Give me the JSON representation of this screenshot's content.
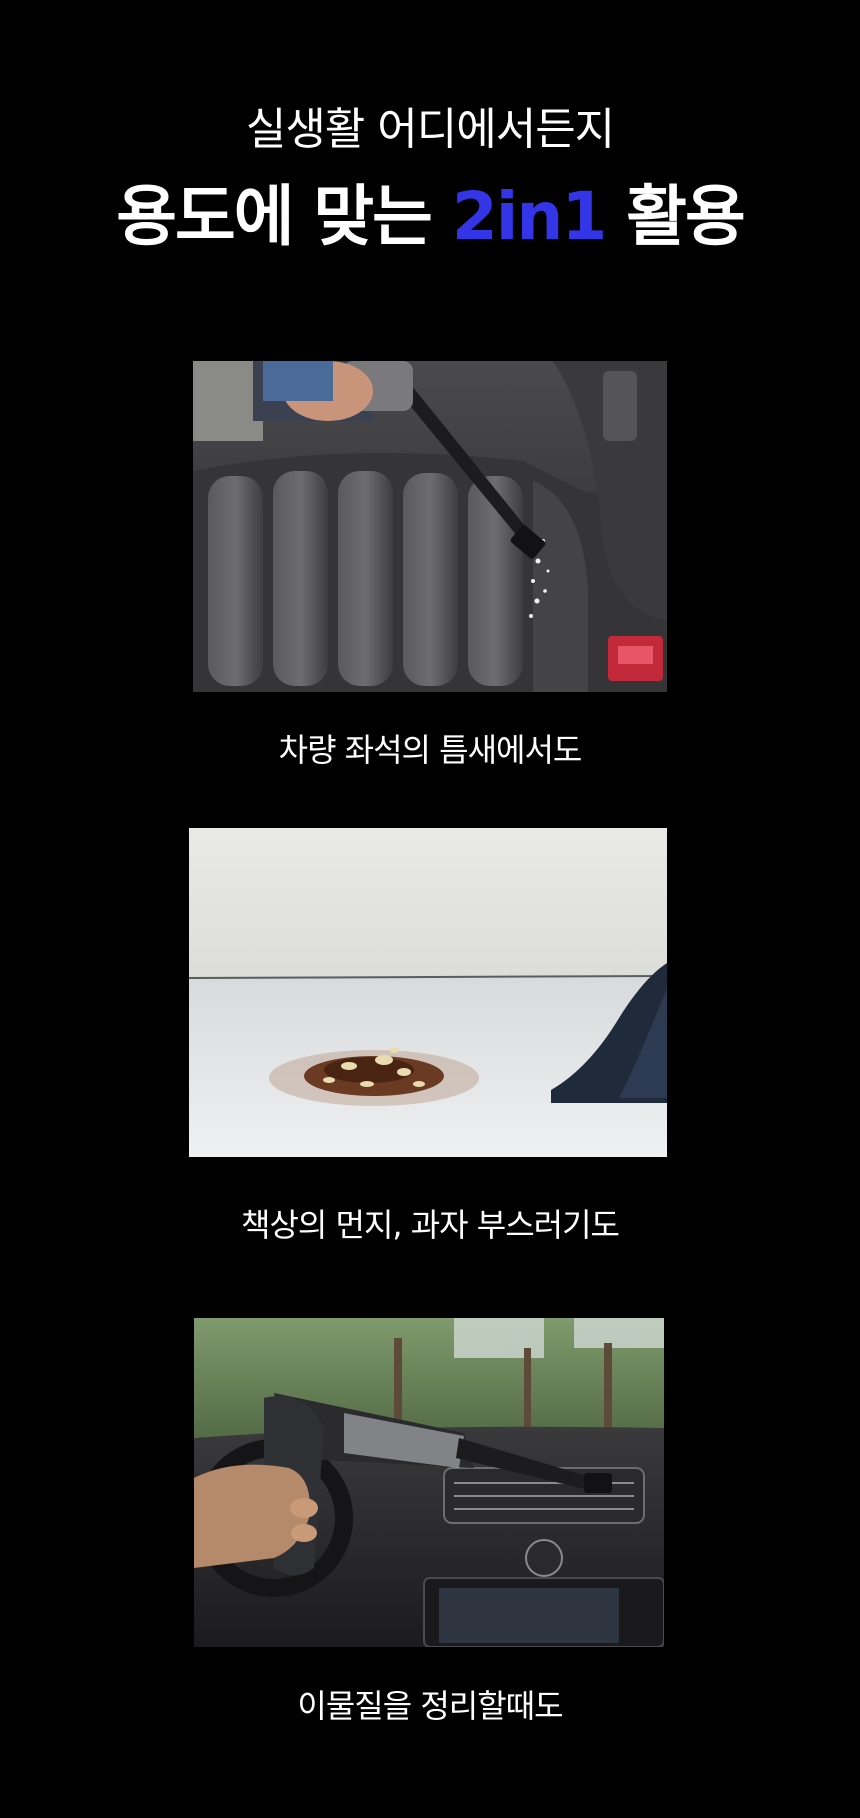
{
  "header": {
    "subtitle": "실생활 어디에서든지",
    "headline_prefix": "용도에 맞는 ",
    "headline_accent": "2in1",
    "headline_suffix": " 활용"
  },
  "sections": [
    {
      "caption": "차량 좌석의 틈새에서도"
    },
    {
      "caption": "책상의 먼지, 과자 부스러기도"
    },
    {
      "caption": "이물질을 정리할때도"
    }
  ],
  "colors": {
    "background": "#000000",
    "text": "#ffffff",
    "accent": "#3535e8"
  }
}
